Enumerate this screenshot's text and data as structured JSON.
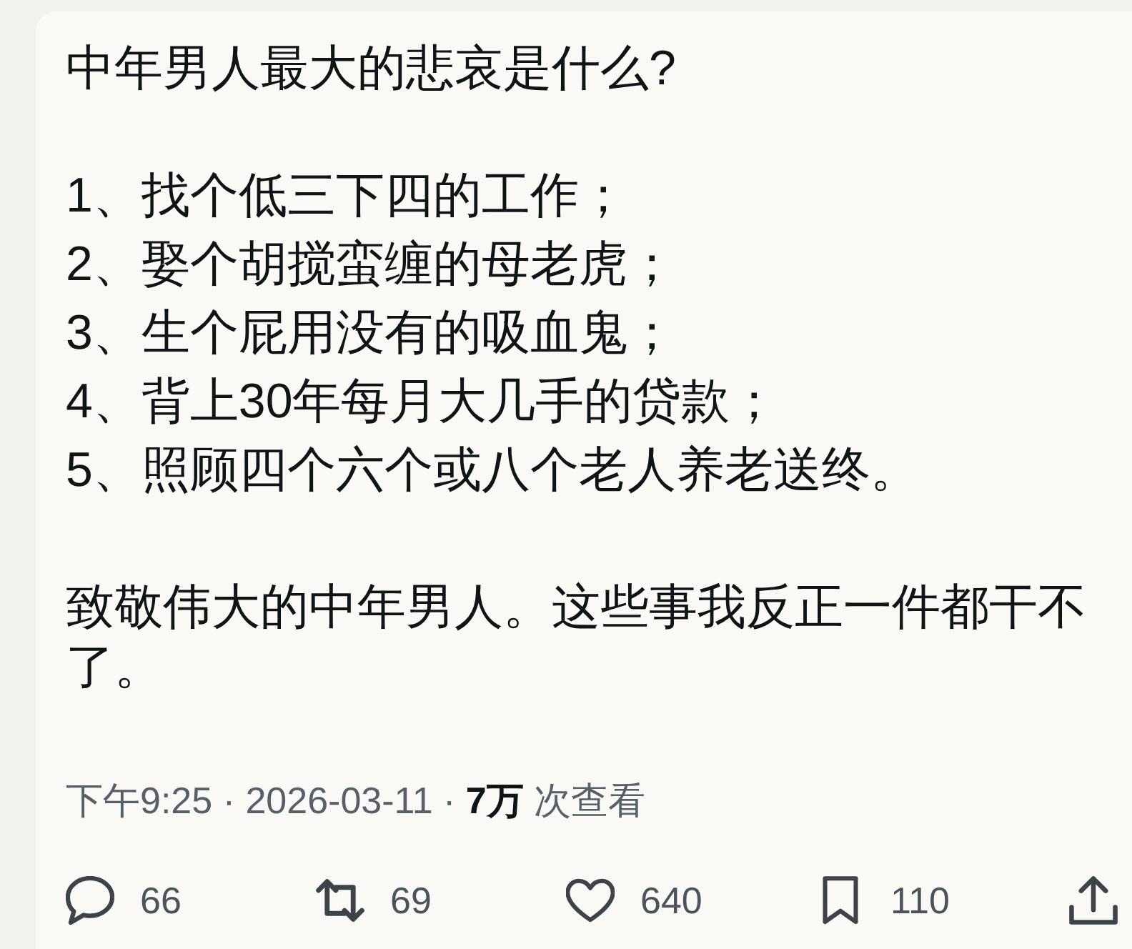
{
  "post": {
    "question": "中年男人最大的悲哀是什么?",
    "list_items": [
      "1、找个低三下四的工作；",
      "2、娶个胡搅蛮缠的母老虎；",
      "3、生个屁用没有的吸血鬼；",
      "4、背上30年每月大几手的贷款；",
      "5、照顾四个六个或八个老人养老送终。"
    ],
    "closing": "致敬伟大的中年男人。这些事我反正一件都干不了。",
    "meta": "下午9:25 · 2026-03-11 · **7万** 次查看"
  },
  "actions": [
    {
      "kind": "reply",
      "count": "66"
    },
    {
      "kind": "repost",
      "count": "69"
    },
    {
      "kind": "like",
      "count": "640"
    },
    {
      "kind": "bookmark",
      "count": "110"
    },
    {
      "kind": "share"
    }
  ]
}
